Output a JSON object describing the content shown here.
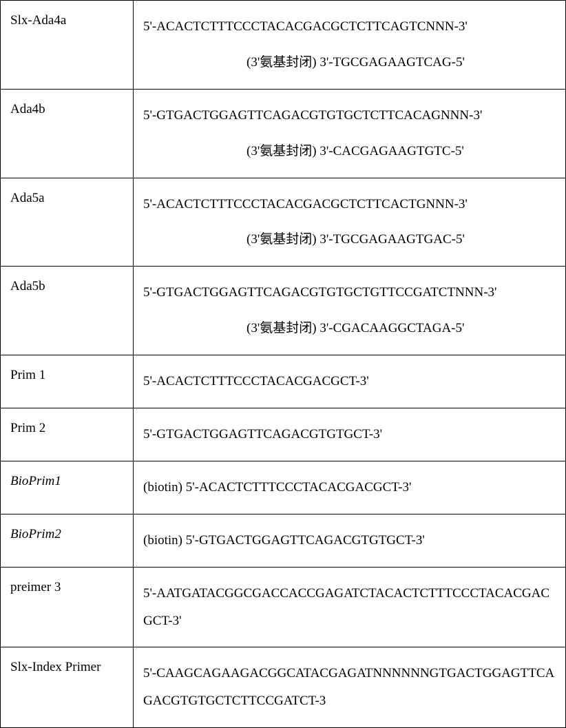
{
  "rows": [
    {
      "label": "Slx-Ada4a",
      "seq_top": "5'-ACACTCTTTCCCTACACGACGCTCTTCAGTCNNN-3'",
      "seq_bot": "(3'氨基封闭) 3'-TGCGAGAAGTCAG-5'"
    },
    {
      "label": "Ada4b",
      "seq_top": "5'-GTGACTGGAGTTCAGACGTGTGCTCTTCACAGNNN-3'",
      "seq_bot": "(3'氨基封闭) 3'-CACGAGAAGTGTC-5'"
    },
    {
      "label": "Ada5a",
      "seq_top": "5'-ACACTCTTTCCCTACACGACGCTCTTCACTGNNN-3'",
      "seq_bot": "(3'氨基封闭) 3'-TGCGAGAAGTGAC-5'"
    },
    {
      "label": "Ada5b",
      "seq_top": "5'-GTGACTGGAGTTCAGACGTGTGCTGTTCCGATCTNNN-3'",
      "seq_bot": "(3'氨基封闭) 3'-CGACAAGGCTAGA-5'"
    },
    {
      "label": "Prim 1",
      "seq_top": "5'-ACACTCTTTCCCTACACGACGCT-3'",
      "seq_bot": ""
    },
    {
      "label": "Prim 2",
      "seq_top": "5'-GTGACTGGAGTTCAGACGTGTGCT-3'",
      "seq_bot": ""
    },
    {
      "label": "BioPrim1",
      "italic": true,
      "seq_top": "(biotin) 5'-ACACTCTTTCCCTACACGACGCT-3'",
      "seq_bot": ""
    },
    {
      "label": "BioPrim2",
      "italic": true,
      "seq_top": "(biotin) 5'-GTGACTGGAGTTCAGACGTGTGCT-3'",
      "seq_bot": ""
    },
    {
      "label": "preimer 3",
      "seq_top": "5'-AATGATACGGCGACCACCGAGATCTACACTCTTTCCCTACACGACGCT-3'",
      "seq_bot": ""
    },
    {
      "label": "Slx-Index Primer",
      "seq_top": "5'-CAAGCAGAAGACGGCATACGAGATNNNNNNGTGACTGGAGTTCAGACGTGTGCTCTTCCGATCT-3",
      "seq_bot": ""
    }
  ]
}
